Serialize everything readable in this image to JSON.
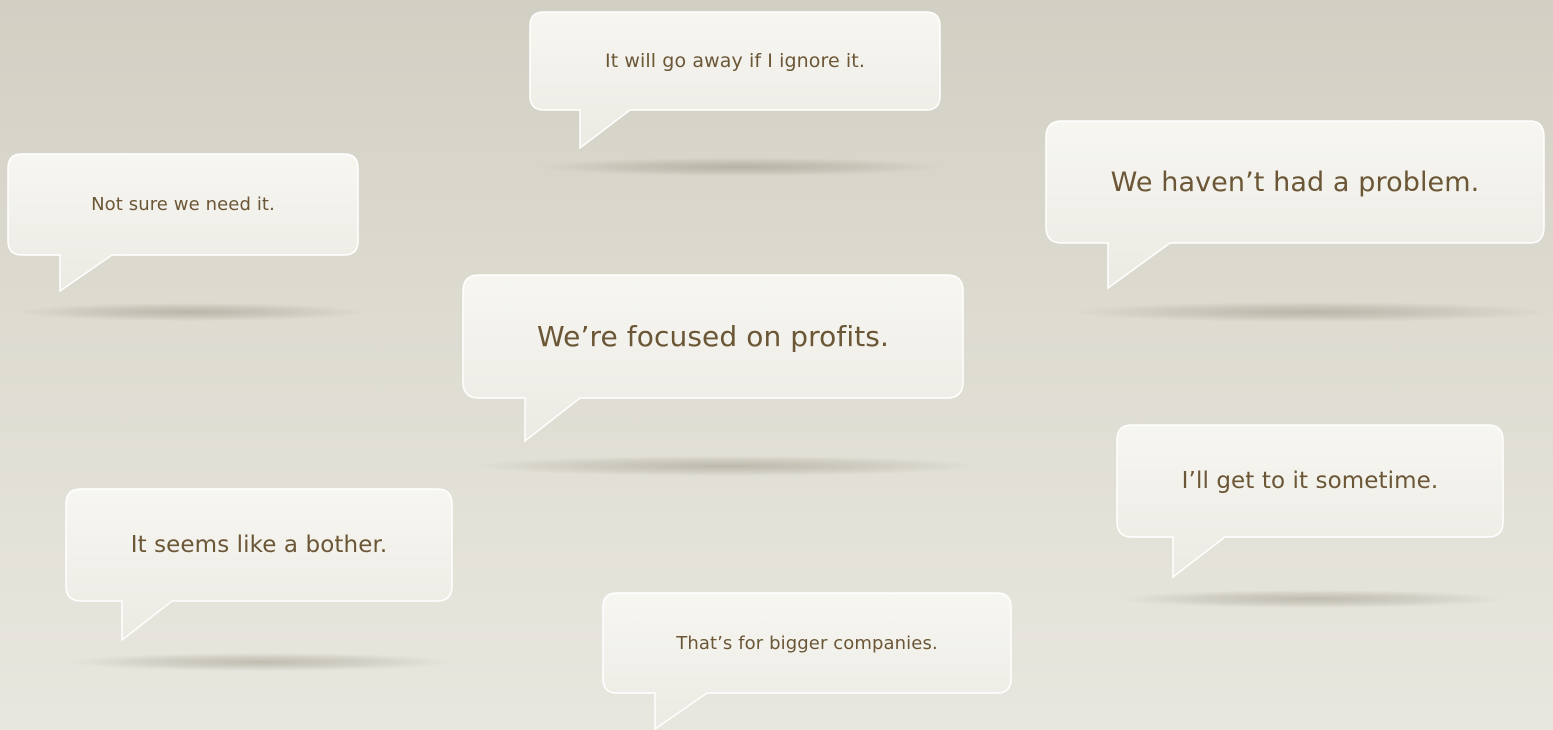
{
  "bubbles": [
    {
      "text": "It will go away if I ignore it."
    },
    {
      "text": "Not sure we need it."
    },
    {
      "text": "We haven’t had a problem."
    },
    {
      "text": "We’re focused on profits."
    },
    {
      "text": "I’ll get to it sometime."
    },
    {
      "text": "It seems like a bother."
    },
    {
      "text": "That’s for bigger companies."
    }
  ],
  "colors": {
    "text": "#6b5636",
    "bubble_fill_top": "#f7f6f1",
    "bubble_fill_bottom": "#ecebe4",
    "bubble_stroke": "#ffffff"
  }
}
